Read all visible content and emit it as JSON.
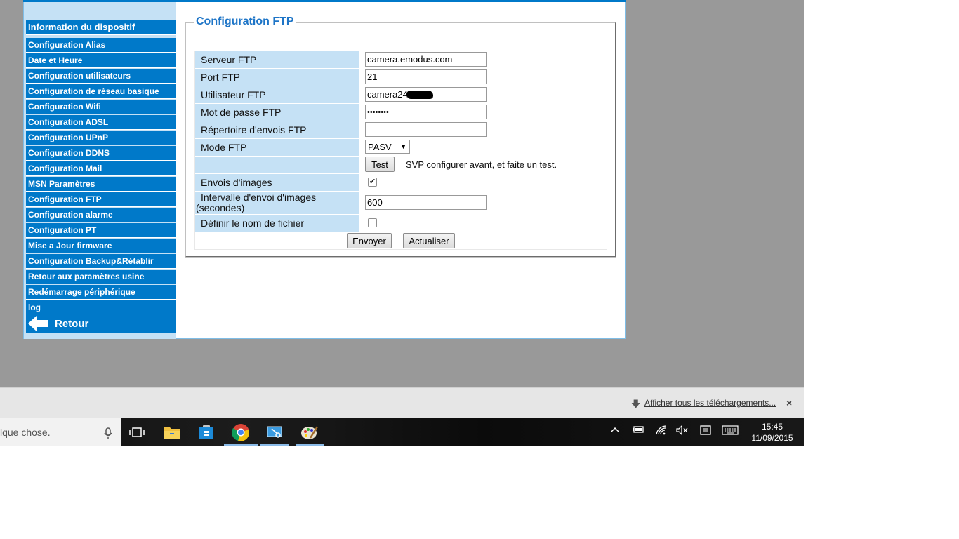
{
  "sidebar": {
    "items": [
      {
        "label": "Information du dispositif"
      },
      {
        "label": "Configuration Alias"
      },
      {
        "label": "Date et Heure"
      },
      {
        "label": "Configuration utilisateurs"
      },
      {
        "label": "Configuration de réseau basique"
      },
      {
        "label": "Configuration Wifi"
      },
      {
        "label": "Configuration ADSL"
      },
      {
        "label": "Configuration UPnP"
      },
      {
        "label": "Configuration DDNS"
      },
      {
        "label": "Configuration Mail"
      },
      {
        "label": "MSN Paramètres"
      },
      {
        "label": "Configuration FTP"
      },
      {
        "label": "Configuration alarme"
      },
      {
        "label": "Configuration PT"
      },
      {
        "label": "Mise a Jour firmware"
      },
      {
        "label": "Configuration Backup&Rétablir"
      },
      {
        "label": "Retour aux paramètres usine"
      },
      {
        "label": "Redémarrage périphérique"
      },
      {
        "label": "log"
      }
    ],
    "back_label": "Retour"
  },
  "form": {
    "title": "Configuration FTP",
    "server_label": "Serveur FTP",
    "server_value": "camera.emodus.com",
    "port_label": "Port FTP",
    "port_value": "21",
    "user_label": "Utilisateur FTP",
    "user_value": "camera24",
    "password_label": "Mot de passe FTP",
    "password_value": "••••••••",
    "dir_label": "Répertoire d'envois FTP",
    "dir_value": "",
    "mode_label": "Mode FTP",
    "mode_value": "PASV",
    "test_button": "Test",
    "test_hint": "SVP configurer avant, et faite un test.",
    "send_images_label": "Envois d'images",
    "send_images_checked": true,
    "interval_label": "Intervalle d'envoi d'images (secondes)",
    "interval_value": "600",
    "filename_label": "Définir le nom de fichier",
    "filename_checked": false,
    "submit_button": "Envoyer",
    "refresh_button": "Actualiser"
  },
  "downloads_bar": {
    "show_all_label": "Afficher tous les téléchargements...",
    "close_glyph": "×"
  },
  "taskbar": {
    "search_text": "lque chose.",
    "time": "15:45",
    "date": "11/09/2015"
  },
  "colors": {
    "nav_blue": "#0079c9",
    "label_bg": "#c5e1f5",
    "title_blue": "#1e75c7"
  }
}
